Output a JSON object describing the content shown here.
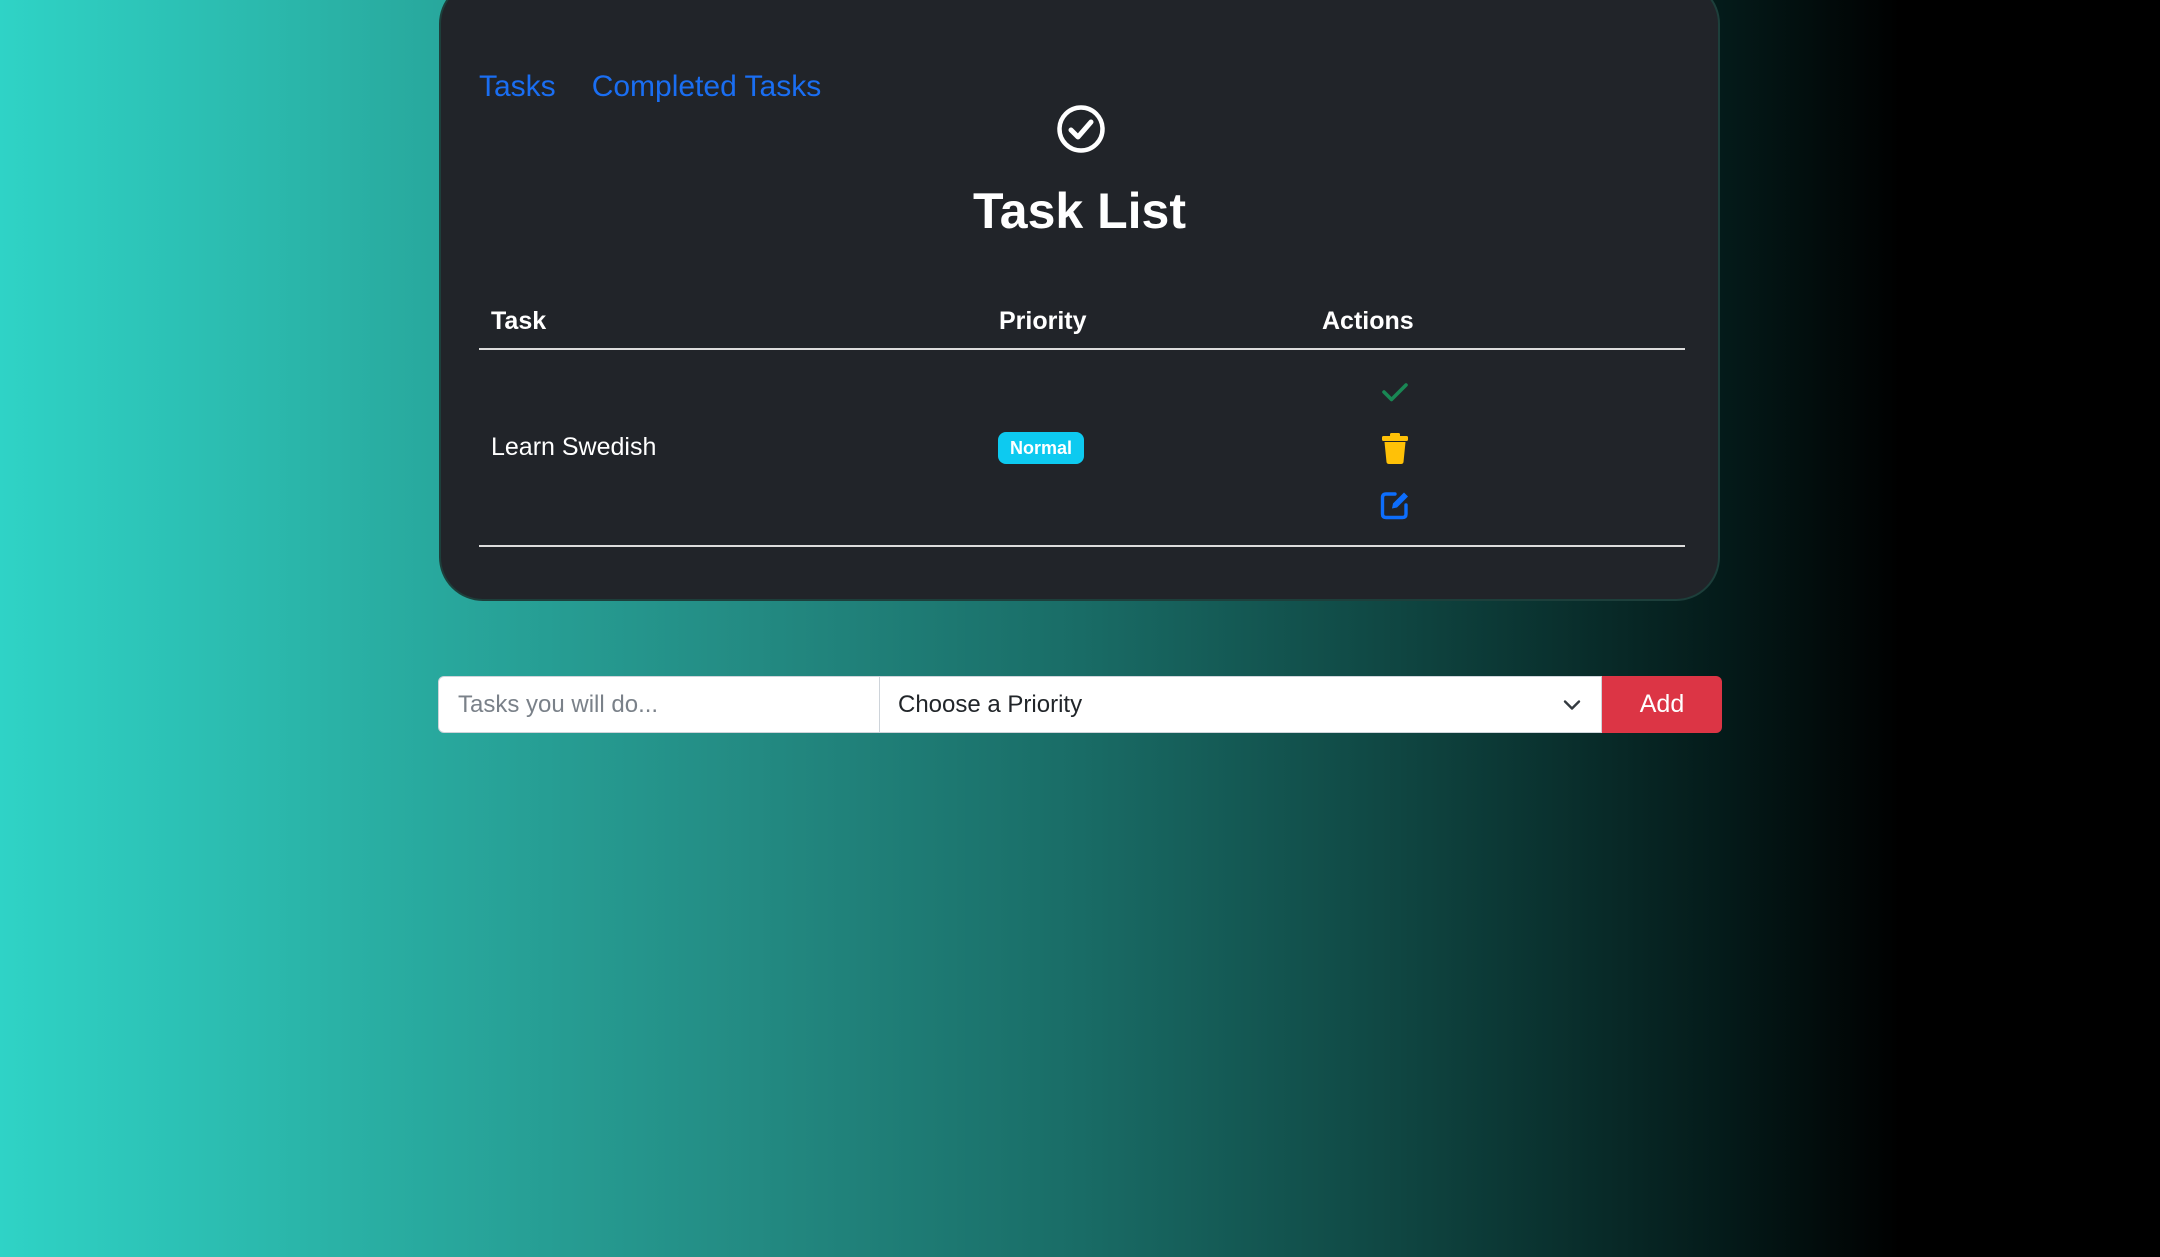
{
  "nav": {
    "tasks_label": "Tasks",
    "completed_label": "Completed Tasks"
  },
  "header": {
    "title": "Task List",
    "icon": "check-circle-icon"
  },
  "table": {
    "columns": [
      "Task",
      "Priority",
      "Actions"
    ],
    "rows": [
      {
        "task": "Learn Swedish",
        "priority": "Normal",
        "actions": [
          "check-icon",
          "trash-icon",
          "edit-icon"
        ]
      }
    ]
  },
  "form": {
    "task_placeholder": "Tasks you will do...",
    "task_value": "",
    "priority_selected": "Choose a Priority",
    "add_label": "Add"
  },
  "colors": {
    "link": "#1a6ef2",
    "card_bg": "#212429",
    "badge_normal": "#0dcaf0",
    "complete_icon": "#198754",
    "delete_icon": "#ffc107",
    "edit_icon": "#0d6efd",
    "add_button": "#dc3545"
  }
}
